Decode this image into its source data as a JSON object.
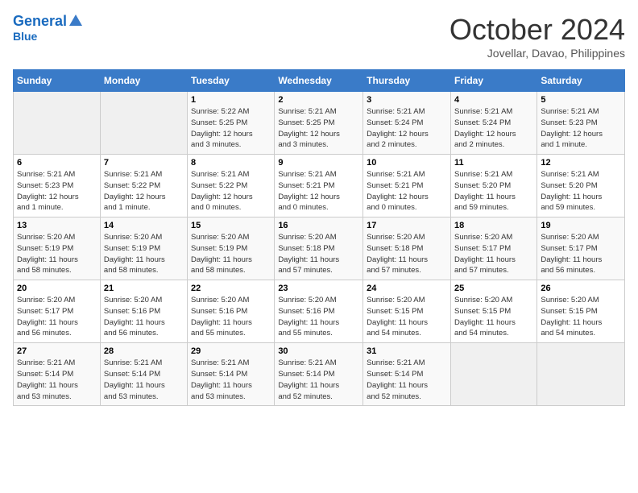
{
  "header": {
    "logo_line1": "General",
    "logo_line2": "Blue",
    "month": "October 2024",
    "location": "Jovellar, Davao, Philippines"
  },
  "weekdays": [
    "Sunday",
    "Monday",
    "Tuesday",
    "Wednesday",
    "Thursday",
    "Friday",
    "Saturday"
  ],
  "weeks": [
    [
      {
        "day": "",
        "detail": ""
      },
      {
        "day": "",
        "detail": ""
      },
      {
        "day": "1",
        "detail": "Sunrise: 5:22 AM\nSunset: 5:25 PM\nDaylight: 12 hours\nand 3 minutes."
      },
      {
        "day": "2",
        "detail": "Sunrise: 5:21 AM\nSunset: 5:25 PM\nDaylight: 12 hours\nand 3 minutes."
      },
      {
        "day": "3",
        "detail": "Sunrise: 5:21 AM\nSunset: 5:24 PM\nDaylight: 12 hours\nand 2 minutes."
      },
      {
        "day": "4",
        "detail": "Sunrise: 5:21 AM\nSunset: 5:24 PM\nDaylight: 12 hours\nand 2 minutes."
      },
      {
        "day": "5",
        "detail": "Sunrise: 5:21 AM\nSunset: 5:23 PM\nDaylight: 12 hours\nand 1 minute."
      }
    ],
    [
      {
        "day": "6",
        "detail": "Sunrise: 5:21 AM\nSunset: 5:23 PM\nDaylight: 12 hours\nand 1 minute."
      },
      {
        "day": "7",
        "detail": "Sunrise: 5:21 AM\nSunset: 5:22 PM\nDaylight: 12 hours\nand 1 minute."
      },
      {
        "day": "8",
        "detail": "Sunrise: 5:21 AM\nSunset: 5:22 PM\nDaylight: 12 hours\nand 0 minutes."
      },
      {
        "day": "9",
        "detail": "Sunrise: 5:21 AM\nSunset: 5:21 PM\nDaylight: 12 hours\nand 0 minutes."
      },
      {
        "day": "10",
        "detail": "Sunrise: 5:21 AM\nSunset: 5:21 PM\nDaylight: 12 hours\nand 0 minutes."
      },
      {
        "day": "11",
        "detail": "Sunrise: 5:21 AM\nSunset: 5:20 PM\nDaylight: 11 hours\nand 59 minutes."
      },
      {
        "day": "12",
        "detail": "Sunrise: 5:21 AM\nSunset: 5:20 PM\nDaylight: 11 hours\nand 59 minutes."
      }
    ],
    [
      {
        "day": "13",
        "detail": "Sunrise: 5:20 AM\nSunset: 5:19 PM\nDaylight: 11 hours\nand 58 minutes."
      },
      {
        "day": "14",
        "detail": "Sunrise: 5:20 AM\nSunset: 5:19 PM\nDaylight: 11 hours\nand 58 minutes."
      },
      {
        "day": "15",
        "detail": "Sunrise: 5:20 AM\nSunset: 5:19 PM\nDaylight: 11 hours\nand 58 minutes."
      },
      {
        "day": "16",
        "detail": "Sunrise: 5:20 AM\nSunset: 5:18 PM\nDaylight: 11 hours\nand 57 minutes."
      },
      {
        "day": "17",
        "detail": "Sunrise: 5:20 AM\nSunset: 5:18 PM\nDaylight: 11 hours\nand 57 minutes."
      },
      {
        "day": "18",
        "detail": "Sunrise: 5:20 AM\nSunset: 5:17 PM\nDaylight: 11 hours\nand 57 minutes."
      },
      {
        "day": "19",
        "detail": "Sunrise: 5:20 AM\nSunset: 5:17 PM\nDaylight: 11 hours\nand 56 minutes."
      }
    ],
    [
      {
        "day": "20",
        "detail": "Sunrise: 5:20 AM\nSunset: 5:17 PM\nDaylight: 11 hours\nand 56 minutes."
      },
      {
        "day": "21",
        "detail": "Sunrise: 5:20 AM\nSunset: 5:16 PM\nDaylight: 11 hours\nand 56 minutes."
      },
      {
        "day": "22",
        "detail": "Sunrise: 5:20 AM\nSunset: 5:16 PM\nDaylight: 11 hours\nand 55 minutes."
      },
      {
        "day": "23",
        "detail": "Sunrise: 5:20 AM\nSunset: 5:16 PM\nDaylight: 11 hours\nand 55 minutes."
      },
      {
        "day": "24",
        "detail": "Sunrise: 5:20 AM\nSunset: 5:15 PM\nDaylight: 11 hours\nand 54 minutes."
      },
      {
        "day": "25",
        "detail": "Sunrise: 5:20 AM\nSunset: 5:15 PM\nDaylight: 11 hours\nand 54 minutes."
      },
      {
        "day": "26",
        "detail": "Sunrise: 5:20 AM\nSunset: 5:15 PM\nDaylight: 11 hours\nand 54 minutes."
      }
    ],
    [
      {
        "day": "27",
        "detail": "Sunrise: 5:21 AM\nSunset: 5:14 PM\nDaylight: 11 hours\nand 53 minutes."
      },
      {
        "day": "28",
        "detail": "Sunrise: 5:21 AM\nSunset: 5:14 PM\nDaylight: 11 hours\nand 53 minutes."
      },
      {
        "day": "29",
        "detail": "Sunrise: 5:21 AM\nSunset: 5:14 PM\nDaylight: 11 hours\nand 53 minutes."
      },
      {
        "day": "30",
        "detail": "Sunrise: 5:21 AM\nSunset: 5:14 PM\nDaylight: 11 hours\nand 52 minutes."
      },
      {
        "day": "31",
        "detail": "Sunrise: 5:21 AM\nSunset: 5:14 PM\nDaylight: 11 hours\nand 52 minutes."
      },
      {
        "day": "",
        "detail": ""
      },
      {
        "day": "",
        "detail": ""
      }
    ]
  ]
}
